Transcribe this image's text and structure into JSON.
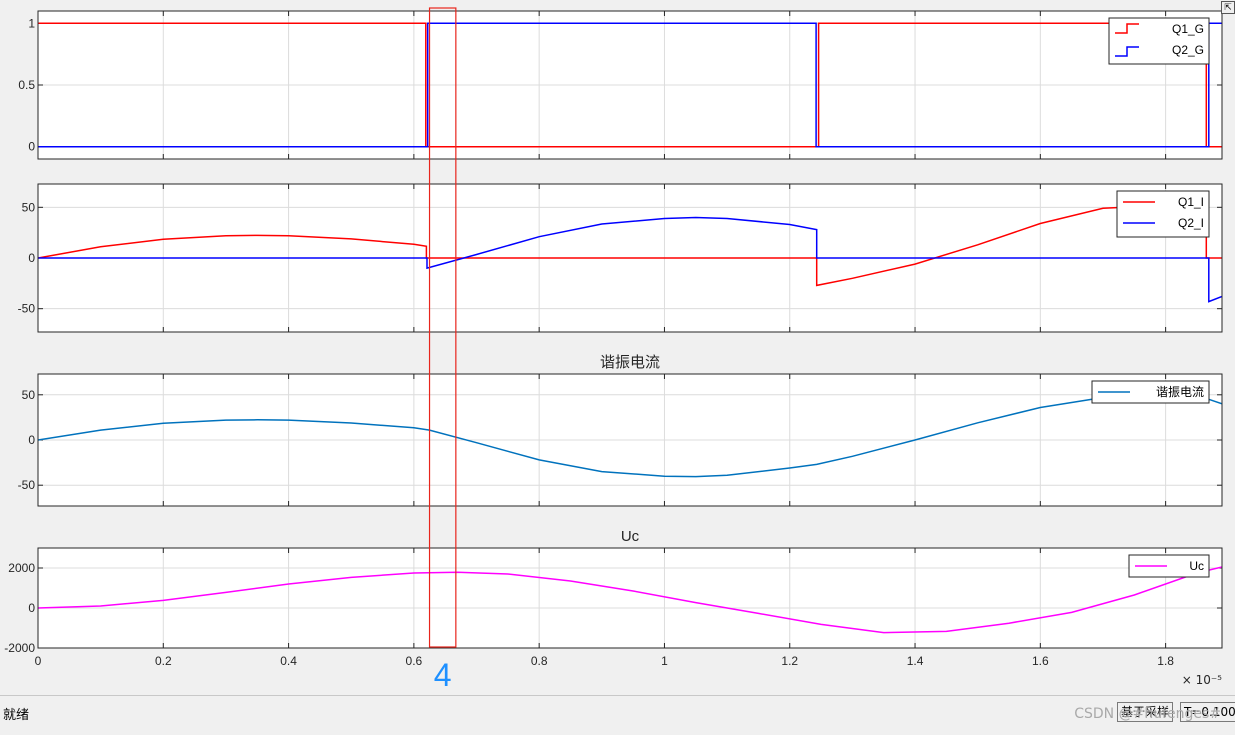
{
  "chart_data": [
    {
      "type": "line",
      "title": "",
      "xlim": [
        0,
        1.89
      ],
      "ylim": [
        -0.1,
        1.1
      ],
      "yticks": [
        0,
        0.5,
        1
      ],
      "ytick_labels": [
        "0",
        "0.5",
        "1"
      ],
      "grid": true,
      "legend_position": "top-right",
      "series": [
        {
          "name": "Q1_G",
          "color": "#ff0000",
          "x": [
            0,
            0.619,
            0.619,
            0.622,
            0.622,
            1.242,
            1.242,
            1.246,
            1.246,
            1.865,
            1.865,
            1.869,
            1.869,
            1.89
          ],
          "y": [
            1,
            1,
            0,
            0,
            0,
            0,
            0,
            0,
            1,
            1,
            0,
            0,
            0,
            0
          ]
        },
        {
          "name": "Q2_G",
          "color": "#0000ff",
          "x": [
            0,
            0.622,
            0.622,
            1.242,
            1.242,
            1.869,
            1.869,
            1.89
          ],
          "y": [
            0,
            0,
            1,
            1,
            0,
            0,
            1,
            1
          ]
        }
      ]
    },
    {
      "type": "line",
      "title": "",
      "xlim": [
        0,
        1.89
      ],
      "ylim": [
        -73,
        73
      ],
      "yticks": [
        -50,
        0,
        50
      ],
      "ytick_labels": [
        "-50",
        "0",
        "50"
      ],
      "grid": true,
      "legend_position": "top-right",
      "series": [
        {
          "name": "Q1_I",
          "color": "#ff0000",
          "x": [
            0,
            0.1,
            0.2,
            0.3,
            0.35,
            0.4,
            0.5,
            0.6,
            0.62,
            0.62,
            1.243,
            1.243,
            1.3,
            1.4,
            1.5,
            1.6,
            1.7,
            1.8,
            1.865,
            1.865,
            1.89
          ],
          "y": [
            0,
            11,
            18.5,
            22,
            22.3,
            22,
            18.8,
            13.5,
            11.5,
            0,
            0,
            -27,
            -20,
            -6,
            13,
            34,
            49,
            52,
            52,
            0,
            0
          ]
        },
        {
          "name": "Q2_I",
          "color": "#0000ff",
          "x": [
            0,
            0.621,
            0.621,
            0.7,
            0.8,
            0.9,
            1.0,
            1.05,
            1.1,
            1.2,
            1.243,
            1.243,
            1.869,
            1.869,
            1.89
          ],
          "y": [
            0,
            0,
            -10,
            3.5,
            21,
            33.5,
            39,
            40,
            39,
            33,
            28,
            0,
            0,
            -43,
            -38
          ]
        }
      ]
    },
    {
      "type": "line",
      "title": "谐振电流",
      "xlim": [
        0,
        1.89
      ],
      "ylim": [
        -73,
        73
      ],
      "yticks": [
        -50,
        0,
        50
      ],
      "ytick_labels": [
        "-50",
        "0",
        "50"
      ],
      "grid": true,
      "legend_position": "top-right",
      "series": [
        {
          "name": "谐振电流",
          "color": "#0072bd",
          "x": [
            0,
            0.1,
            0.2,
            0.3,
            0.35,
            0.4,
            0.5,
            0.6,
            0.625,
            0.7,
            0.8,
            0.9,
            1.0,
            1.05,
            1.1,
            1.2,
            1.243,
            1.3,
            1.4,
            1.5,
            1.6,
            1.7,
            1.8,
            1.869,
            1.89
          ],
          "y": [
            0,
            11,
            18.5,
            22,
            22.3,
            22,
            18.8,
            13.5,
            11,
            -3,
            -22,
            -35,
            -40,
            -40.5,
            -39,
            -31,
            -27,
            -18,
            0,
            19,
            36,
            47,
            51,
            45,
            40
          ]
        }
      ]
    },
    {
      "type": "line",
      "title": "Uc",
      "xlim": [
        0,
        1.89
      ],
      "ylim": [
        -2000,
        3000
      ],
      "yticks": [
        -2000,
        0,
        2000
      ],
      "ytick_labels": [
        "-2000",
        "0",
        "2000"
      ],
      "grid": true,
      "legend_position": "top-right",
      "series": [
        {
          "name": "Uc",
          "color": "#ff00ff",
          "x": [
            0,
            0.1,
            0.2,
            0.3,
            0.4,
            0.5,
            0.6,
            0.67,
            0.75,
            0.85,
            0.95,
            1.05,
            1.15,
            1.25,
            1.35,
            1.45,
            1.55,
            1.65,
            1.75,
            1.85,
            1.89
          ],
          "y": [
            0,
            100,
            380,
            780,
            1200,
            1530,
            1750,
            1790,
            1700,
            1350,
            850,
            270,
            -270,
            -820,
            -1230,
            -1170,
            -760,
            -220,
            650,
            1750,
            2050
          ]
        }
      ],
      "xticks": [
        0,
        0.2,
        0.4,
        0.6,
        0.8,
        1,
        1.2,
        1.4,
        1.6,
        1.8
      ],
      "xtick_labels": [
        "0",
        "0.2",
        "0.4",
        "0.6",
        "0.8",
        "1",
        "1.2",
        "1.4",
        "1.6",
        "1.8"
      ],
      "x_multiplier": "× 10⁻⁵"
    }
  ],
  "annotation": {
    "label": "4",
    "x_range": [
      0.625,
      0.667
    ],
    "box_color": "#e8251c",
    "label_color": "#1e90ff"
  },
  "colors": {
    "axes_bg": "#ffffff",
    "figure_bg": "#f0f0f0",
    "grid": "#dcdcdc"
  },
  "status": {
    "text": "就绪",
    "sample_mode": "基于采样",
    "time": "T=0.100"
  },
  "watermark": "CSDN @#hufenges#",
  "icons": {
    "restore": "restore-icon"
  }
}
